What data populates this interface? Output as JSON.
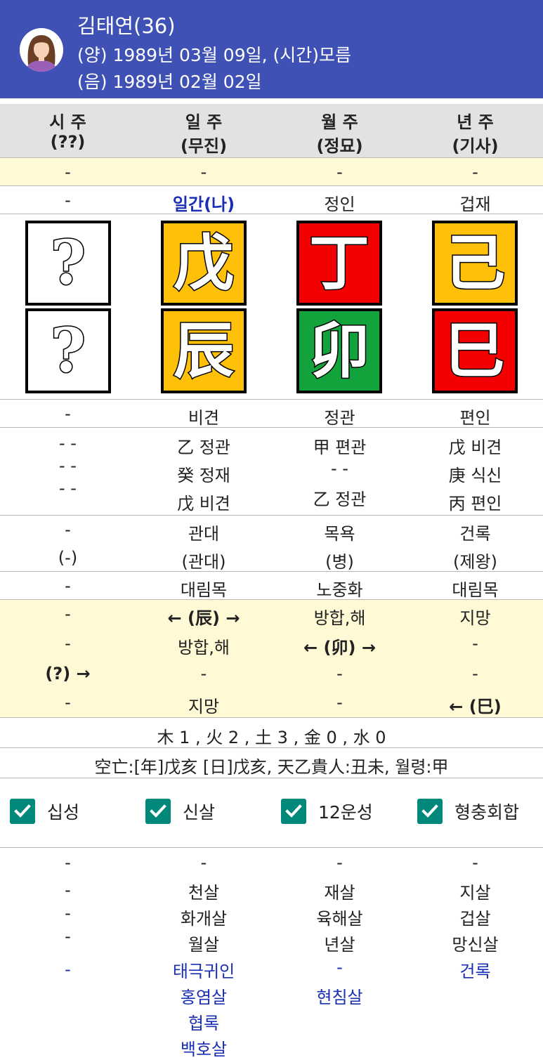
{
  "profile": {
    "name": "김태연(36)",
    "solar": "(양) 1989년 03월 09일, (시간)모름",
    "lunar": "(음) 1989년 02월 02일"
  },
  "pillars": [
    {
      "title": "시 주",
      "sub": "(??)"
    },
    {
      "title": "일 주",
      "sub": "(무진)"
    },
    {
      "title": "월 주",
      "sub": "(정묘)"
    },
    {
      "title": "년 주",
      "sub": "(기사)"
    }
  ],
  "row_dash": [
    "-",
    "-",
    "-",
    "-"
  ],
  "ten_gods_stem": [
    "-",
    "일간(나)",
    "정인",
    "겁재"
  ],
  "stems": [
    {
      "char": "?",
      "color": "#ffffff"
    },
    {
      "char": "戊",
      "color": "#ffc107"
    },
    {
      "char": "丁",
      "color": "#f50000"
    },
    {
      "char": "己",
      "color": "#ffc107"
    }
  ],
  "branches": [
    {
      "char": "?",
      "color": "#ffffff"
    },
    {
      "char": "辰",
      "color": "#ffc107"
    },
    {
      "char": "卯",
      "color": "#12a33d"
    },
    {
      "char": "巳",
      "color": "#f50000"
    }
  ],
  "ten_gods_branch": [
    "-",
    "비견",
    "정관",
    "편인"
  ],
  "hidden_stems": [
    [
      "- -",
      "- -",
      "- -"
    ],
    [
      "乙 정관",
      "癸 정재",
      "戊 비견"
    ],
    [
      "甲 편관",
      "- -",
      "乙 정관"
    ],
    [
      "戊 비견",
      "庚 식신",
      "丙 편인"
    ]
  ],
  "twelve_stages": [
    [
      "-",
      "(-)"
    ],
    [
      "관대",
      "(관대)"
    ],
    [
      "목욕",
      "(병)"
    ],
    [
      "건록",
      "(제왕)"
    ]
  ],
  "nayin": [
    "-",
    "대림목",
    "노중화",
    "대림목"
  ],
  "relations": [
    [
      "-",
      "-",
      "(?) →",
      "-"
    ],
    [
      "← (辰) →",
      "방합,해",
      "-",
      "지망"
    ],
    [
      "방합,해",
      "← (卯) →",
      "-",
      "-"
    ],
    [
      "지망",
      "-",
      "-",
      "← (巳)"
    ]
  ],
  "elements": "木 1 , 火 2 , 土 3 , 金 0 , 水 0",
  "gongmang": "空亡:[年]戊亥 [日]戊亥, 天乙貴人:丑未, 월령:甲",
  "checkboxes": [
    "십성",
    "신살",
    "12운성",
    "형충회합"
  ],
  "sinsal": [
    {
      "black": [
        "-",
        "-",
        "-",
        "-"
      ],
      "blue": [
        "-"
      ]
    },
    {
      "black": [
        "-",
        "천살",
        "화개살",
        "월살"
      ],
      "blue": [
        "태극귀인",
        "홍염살",
        "협록",
        "백호살"
      ]
    },
    {
      "black": [
        "-",
        "재살",
        "육해살",
        "년살"
      ],
      "blue": [
        "-",
        "현침살"
      ]
    },
    {
      "black": [
        "-",
        "지살",
        "겁살",
        "망신살"
      ],
      "blue": [
        "건록"
      ]
    }
  ],
  "colors": {
    "header": "#3f51b5",
    "highlight": "#fff9d6",
    "column_header": "#e2e2e2",
    "checkbox": "#00897b",
    "accent_text": "#1a2fb3"
  }
}
